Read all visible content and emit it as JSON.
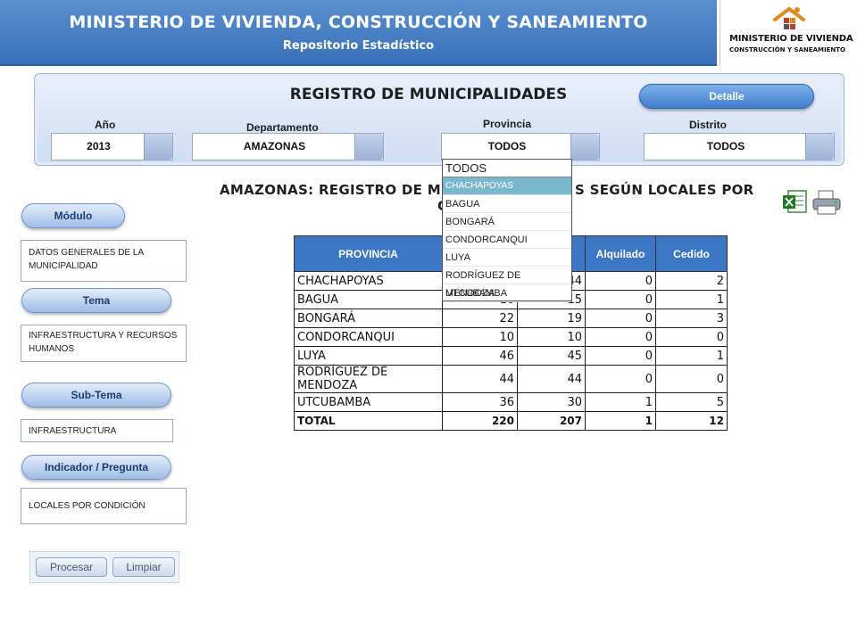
{
  "header": {
    "title": "MINISTERIO DE VIVIENDA, CONSTRUCCIÓN Y SANEAMIENTO",
    "subtitle": "Repositorio Estadístico",
    "logo_line1": "MINISTERIO DE VIVIENDA",
    "logo_line2": "CONSTRUCCIÓN Y SANEAMIENTO"
  },
  "panel": {
    "title": "REGISTRO DE MUNICIPALIDADES",
    "detail_button": "Detalle",
    "filters": {
      "anio": {
        "label": "Año",
        "value": "2013"
      },
      "departamento": {
        "label": "Departamento",
        "value": "AMAZONAS"
      },
      "provincia": {
        "label": "Provincia",
        "value": "TODOS"
      },
      "distrito": {
        "label": "Distrito",
        "value": "TODOS"
      }
    }
  },
  "provincia_dropdown": {
    "options": [
      "TODOS",
      "CHACHAPOYAS",
      "BAGUA",
      "BONGARÁ",
      "CONDORCANQUI",
      "LUYA",
      "RODRÍGUEZ DE MENDOZA",
      "UTCUBAMBA"
    ],
    "highlighted": "CHACHAPOYAS"
  },
  "report": {
    "title_line1": "AMAZONAS: REGISTRO DE M",
    "title_line1_tail": "S SEGÚN LOCALES POR",
    "title_line2": "C"
  },
  "sidebar": {
    "modulo": {
      "label": "Módulo",
      "value": "DATOS GENERALES DE LA MUNICIPALIDAD"
    },
    "tema": {
      "label": "Tema",
      "value": "INFRAESTRUCTURA Y RECURSOS HUMANOS"
    },
    "subtema": {
      "label": "Sub-Tema",
      "value": "INFRAESTRUCTURA"
    },
    "indicador": {
      "label": "Indicador / Pregunta",
      "value": "LOCALES POR CONDICIÓN"
    },
    "procesar": "Procesar",
    "limpiar": "Limpiar"
  },
  "table": {
    "headers": [
      "PROVINCIA",
      "",
      "",
      "Alquilado",
      "Cedido"
    ],
    "rows": [
      [
        "CHACHAPOYAS",
        "",
        "44",
        "0",
        "2"
      ],
      [
        "BAGUA",
        "16",
        "15",
        "0",
        "1"
      ],
      [
        "BONGARÁ",
        "22",
        "19",
        "0",
        "3"
      ],
      [
        "CONDORCANQUI",
        "10",
        "10",
        "0",
        "0"
      ],
      [
        "LUYA",
        "46",
        "45",
        "0",
        "1"
      ],
      [
        "RODRÍGUEZ DE MENDOZA",
        "44",
        "44",
        "0",
        "0"
      ],
      [
        "UTCUBAMBA",
        "36",
        "30",
        "1",
        "5"
      ]
    ],
    "total": [
      "TOTAL",
      "220",
      "207",
      "1",
      "12"
    ]
  },
  "icons": {
    "excel": "excel-export-icon",
    "print": "printer-icon"
  },
  "colors": {
    "header_blue": "#3a70b8",
    "table_header": "#3b77c5",
    "dropdown_highlight": "#79b8cc"
  }
}
